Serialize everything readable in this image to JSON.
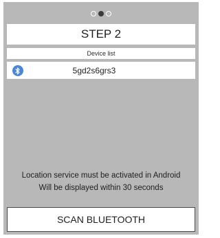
{
  "stepper": {
    "total": 3,
    "current": 2
  },
  "header": {
    "title": "STEP 2"
  },
  "device_list": {
    "label": "Device list",
    "items": [
      {
        "name": "5gd2s6grs3",
        "icon": "bluetooth-icon"
      }
    ]
  },
  "notice": {
    "line1": "Location service must be activated in Android",
    "line2": "Will be displayed within 30 seconds"
  },
  "actions": {
    "scan_label": "SCAN BLUETOOTH"
  },
  "colors": {
    "panel_bg": "#b8b8b8",
    "bluetooth_badge": "#4a86d8",
    "active_dot": "#3a3a3a"
  }
}
